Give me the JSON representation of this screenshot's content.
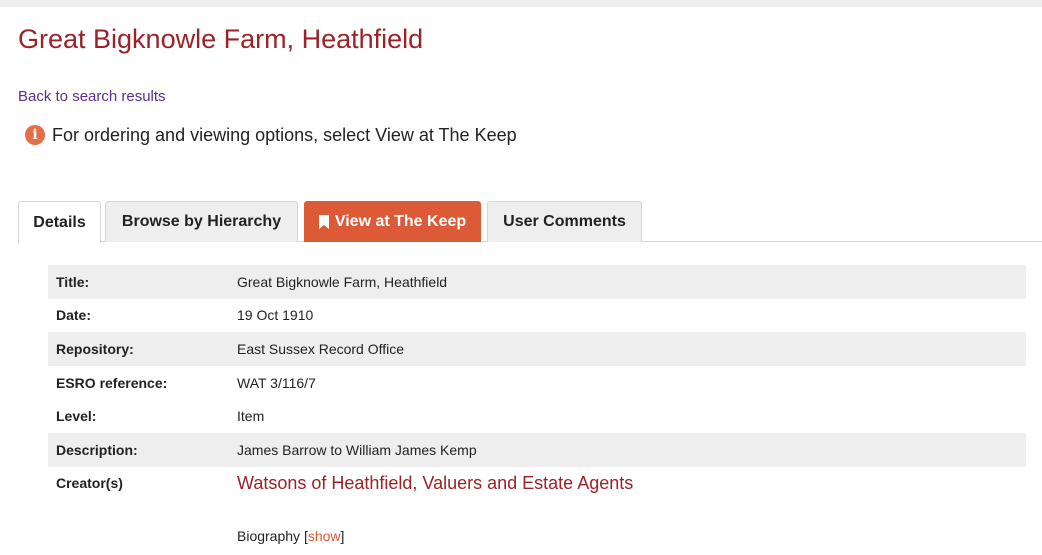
{
  "page": {
    "title": "Great Bigknowle Farm, Heathfield",
    "back_link": "Back to search results",
    "notice": "For ordering and viewing options, select View at The Keep",
    "notice_icon": "info-icon"
  },
  "tabs": [
    {
      "label": "Details",
      "active": true
    },
    {
      "label": "Browse by Hierarchy",
      "active": false
    },
    {
      "label": "View at The Keep",
      "active": false,
      "icon": "bookmark-icon"
    },
    {
      "label": "User Comments",
      "active": false
    }
  ],
  "details": [
    {
      "label": "Title:",
      "value": "Great Bigknowle Farm, Heathfield"
    },
    {
      "label": "Date:",
      "value": "19 Oct 1910"
    },
    {
      "label": "Repository:",
      "value": "East Sussex Record Office"
    },
    {
      "label": "ESRO reference:",
      "value": "WAT 3/116/7"
    },
    {
      "label": "Level:",
      "value": "Item"
    },
    {
      "label": "Description:",
      "value": "James Barrow to William James Kemp"
    }
  ],
  "creator": {
    "label": "Creator(s)",
    "link": "Watsons of Heathfield, Valuers and Estate Agents"
  },
  "biography": {
    "label": "Biography",
    "open_bracket": "[",
    "show": "show",
    "close_bracket": "]"
  },
  "colors": {
    "title": "#9b2226",
    "link": "#5b2d8e",
    "accent": "#dd5a37",
    "row_shade": "#eeeeee"
  }
}
